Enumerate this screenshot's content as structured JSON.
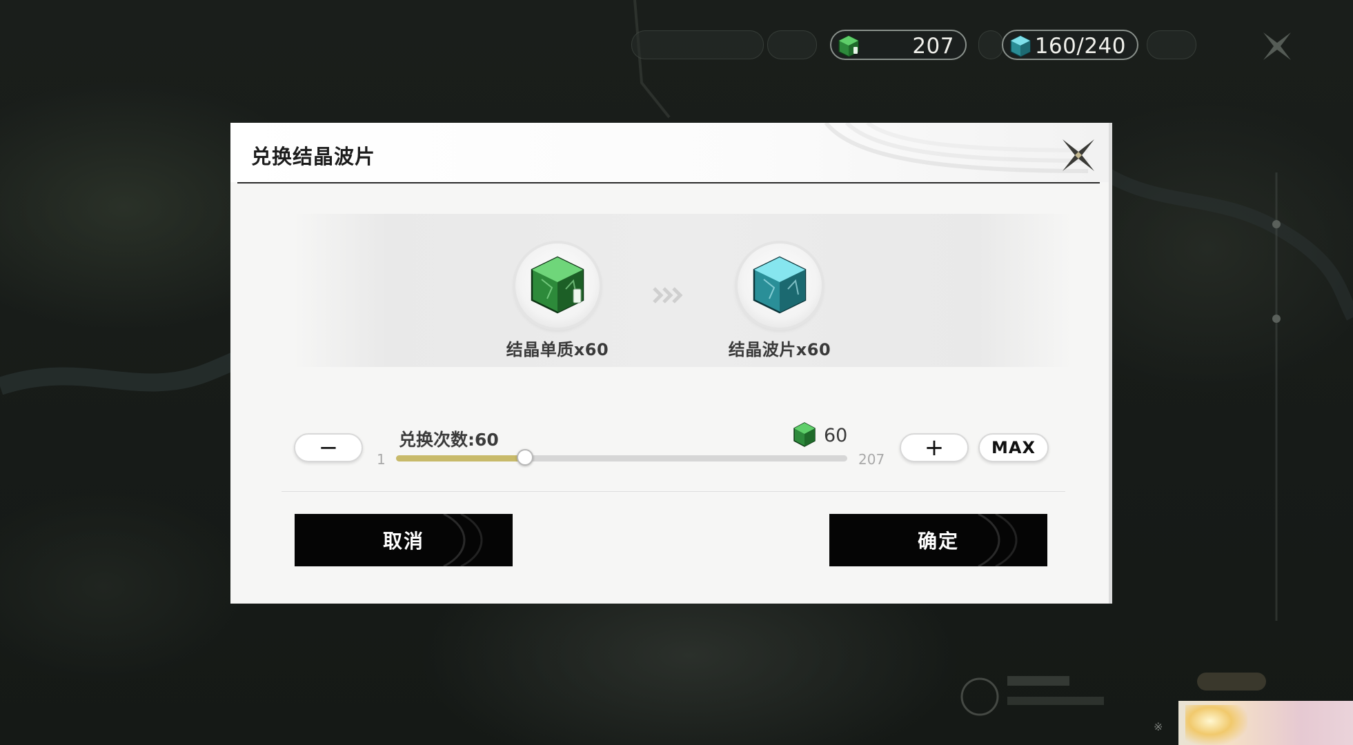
{
  "hud": {
    "crystal_matter_count": "207",
    "crystal_wave_count": "160/240"
  },
  "dialog": {
    "title": "兑换结晶波片",
    "source_item": {
      "name": "结晶单质x60",
      "icon": "green-crystal-cube-icon"
    },
    "target_item": {
      "name": "结晶波片x60",
      "icon": "cyan-crystal-cube-icon"
    },
    "count_label": "兑换次数:60",
    "slider": {
      "min": "1",
      "max": "207",
      "value": 60
    },
    "cost_value": "60",
    "minus_label": "−",
    "plus_label": "+",
    "max_label": "MAX",
    "cancel_label": "取消",
    "confirm_label": "确定"
  },
  "colors": {
    "slider_fill": "#c8ba6a",
    "button_dark": "#050505",
    "dialog_bg": "#f6f6f5"
  }
}
